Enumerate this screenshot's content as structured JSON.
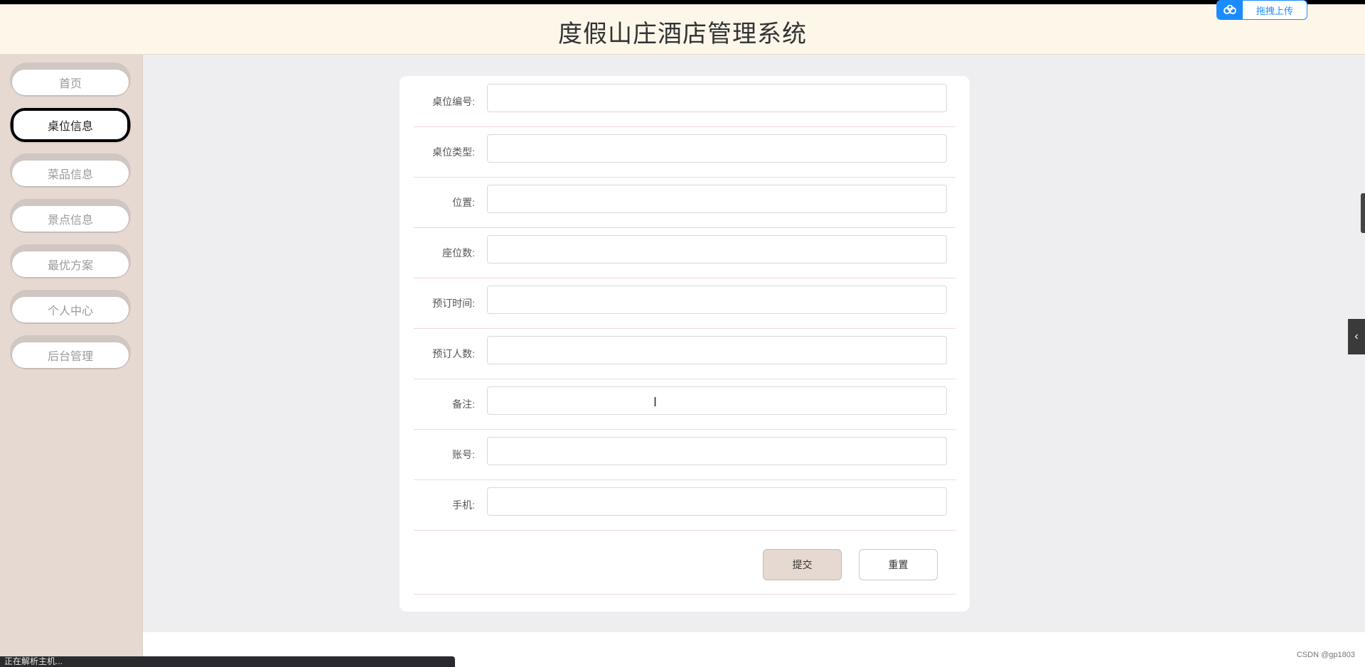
{
  "header": {
    "title": "度假山庄酒店管理系统",
    "upload_label": "拖拽上传"
  },
  "sidebar": {
    "items": [
      {
        "label": "首页",
        "active": false
      },
      {
        "label": "桌位信息",
        "active": true
      },
      {
        "label": "菜品信息",
        "active": false
      },
      {
        "label": "景点信息",
        "active": false
      },
      {
        "label": "最优方案",
        "active": false
      },
      {
        "label": "个人中心",
        "active": false
      },
      {
        "label": "后台管理",
        "active": false
      }
    ]
  },
  "form": {
    "fields": [
      {
        "label": "桌位编号:",
        "value": "",
        "placeholder": ""
      },
      {
        "label": "桌位类型:",
        "value": "",
        "placeholder": ""
      },
      {
        "label": "位置:",
        "value": "",
        "placeholder": ""
      },
      {
        "label": "座位数:",
        "value": "",
        "placeholder": ""
      },
      {
        "label": "预订时间:",
        "value": "",
        "placeholder": ""
      },
      {
        "label": "预订人数:",
        "value": "",
        "placeholder": ""
      },
      {
        "label": "备注:",
        "value": "",
        "placeholder": ""
      },
      {
        "label": "账号:",
        "value": "",
        "placeholder": ""
      },
      {
        "label": "手机:",
        "value": "",
        "placeholder": ""
      }
    ],
    "submit_label": "提交",
    "reset_label": "重置"
  },
  "statusbar": {
    "text": "正在解析主机..."
  },
  "watermark": {
    "text": "CSDN @gp1803"
  },
  "colors": {
    "sidebar_bg": "#e6d9d1",
    "header_bg": "#fdf7ea",
    "content_bg": "#eeeef0",
    "accent_blue": "#1a8cff"
  }
}
